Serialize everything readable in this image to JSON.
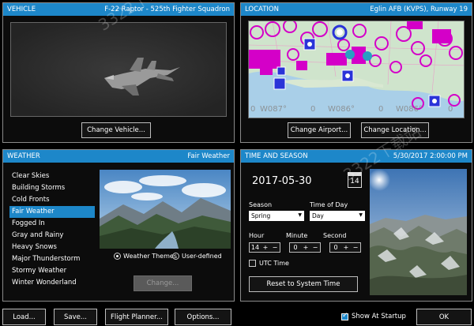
{
  "vehicle": {
    "header_title": "VEHICLE",
    "header_value": "F-22 Raptor - 525th Fighter Squadron",
    "change_button": "Change Vehicle..."
  },
  "location": {
    "header_title": "LOCATION",
    "header_value": "Eglin AFB (KVPS), Runway 19",
    "change_airport_button": "Change Airport...",
    "change_location_button": "Change Location...",
    "map_coords": [
      "0",
      "W087°",
      "0",
      "W086°",
      "0",
      "W086°",
      "0"
    ]
  },
  "weather": {
    "header_title": "WEATHER",
    "header_value": "Fair Weather",
    "themes": [
      "Clear Skies",
      "Building Storms",
      "Cold Fronts",
      "Fair Weather",
      "Fogged In",
      "Gray and Rainy",
      "Heavy Snows",
      "Major Thunderstorm",
      "Stormy Weather",
      "Winter Wonderland"
    ],
    "selected_index": 3,
    "radio_themes": "Weather Themes",
    "radio_user": "User-defined",
    "change_button": "Change..."
  },
  "time": {
    "header_title": "TIME AND SEASON",
    "header_value": "5/30/2017 2:00:00 PM",
    "date": "2017-05-30",
    "calendar_day": "14",
    "season_label": "Season",
    "season_value": "Spring",
    "tod_label": "Time of Day",
    "tod_value": "Day",
    "hour_label": "Hour",
    "hour_value": "14",
    "minute_label": "Minute",
    "minute_value": "0",
    "second_label": "Second",
    "second_value": "0",
    "utc_label": "UTC Time",
    "reset_button": "Reset to System Time"
  },
  "footer": {
    "load": "Load...",
    "save": "Save...",
    "flight_planner": "Flight Planner...",
    "options": "Options...",
    "show_at_startup": "Show At Startup",
    "ok": "OK"
  },
  "watermark": "3322下载站",
  "colors": {
    "accent": "#1d87c9",
    "map_marker": "#d400c8",
    "airport_marker": "#2a33d8"
  }
}
